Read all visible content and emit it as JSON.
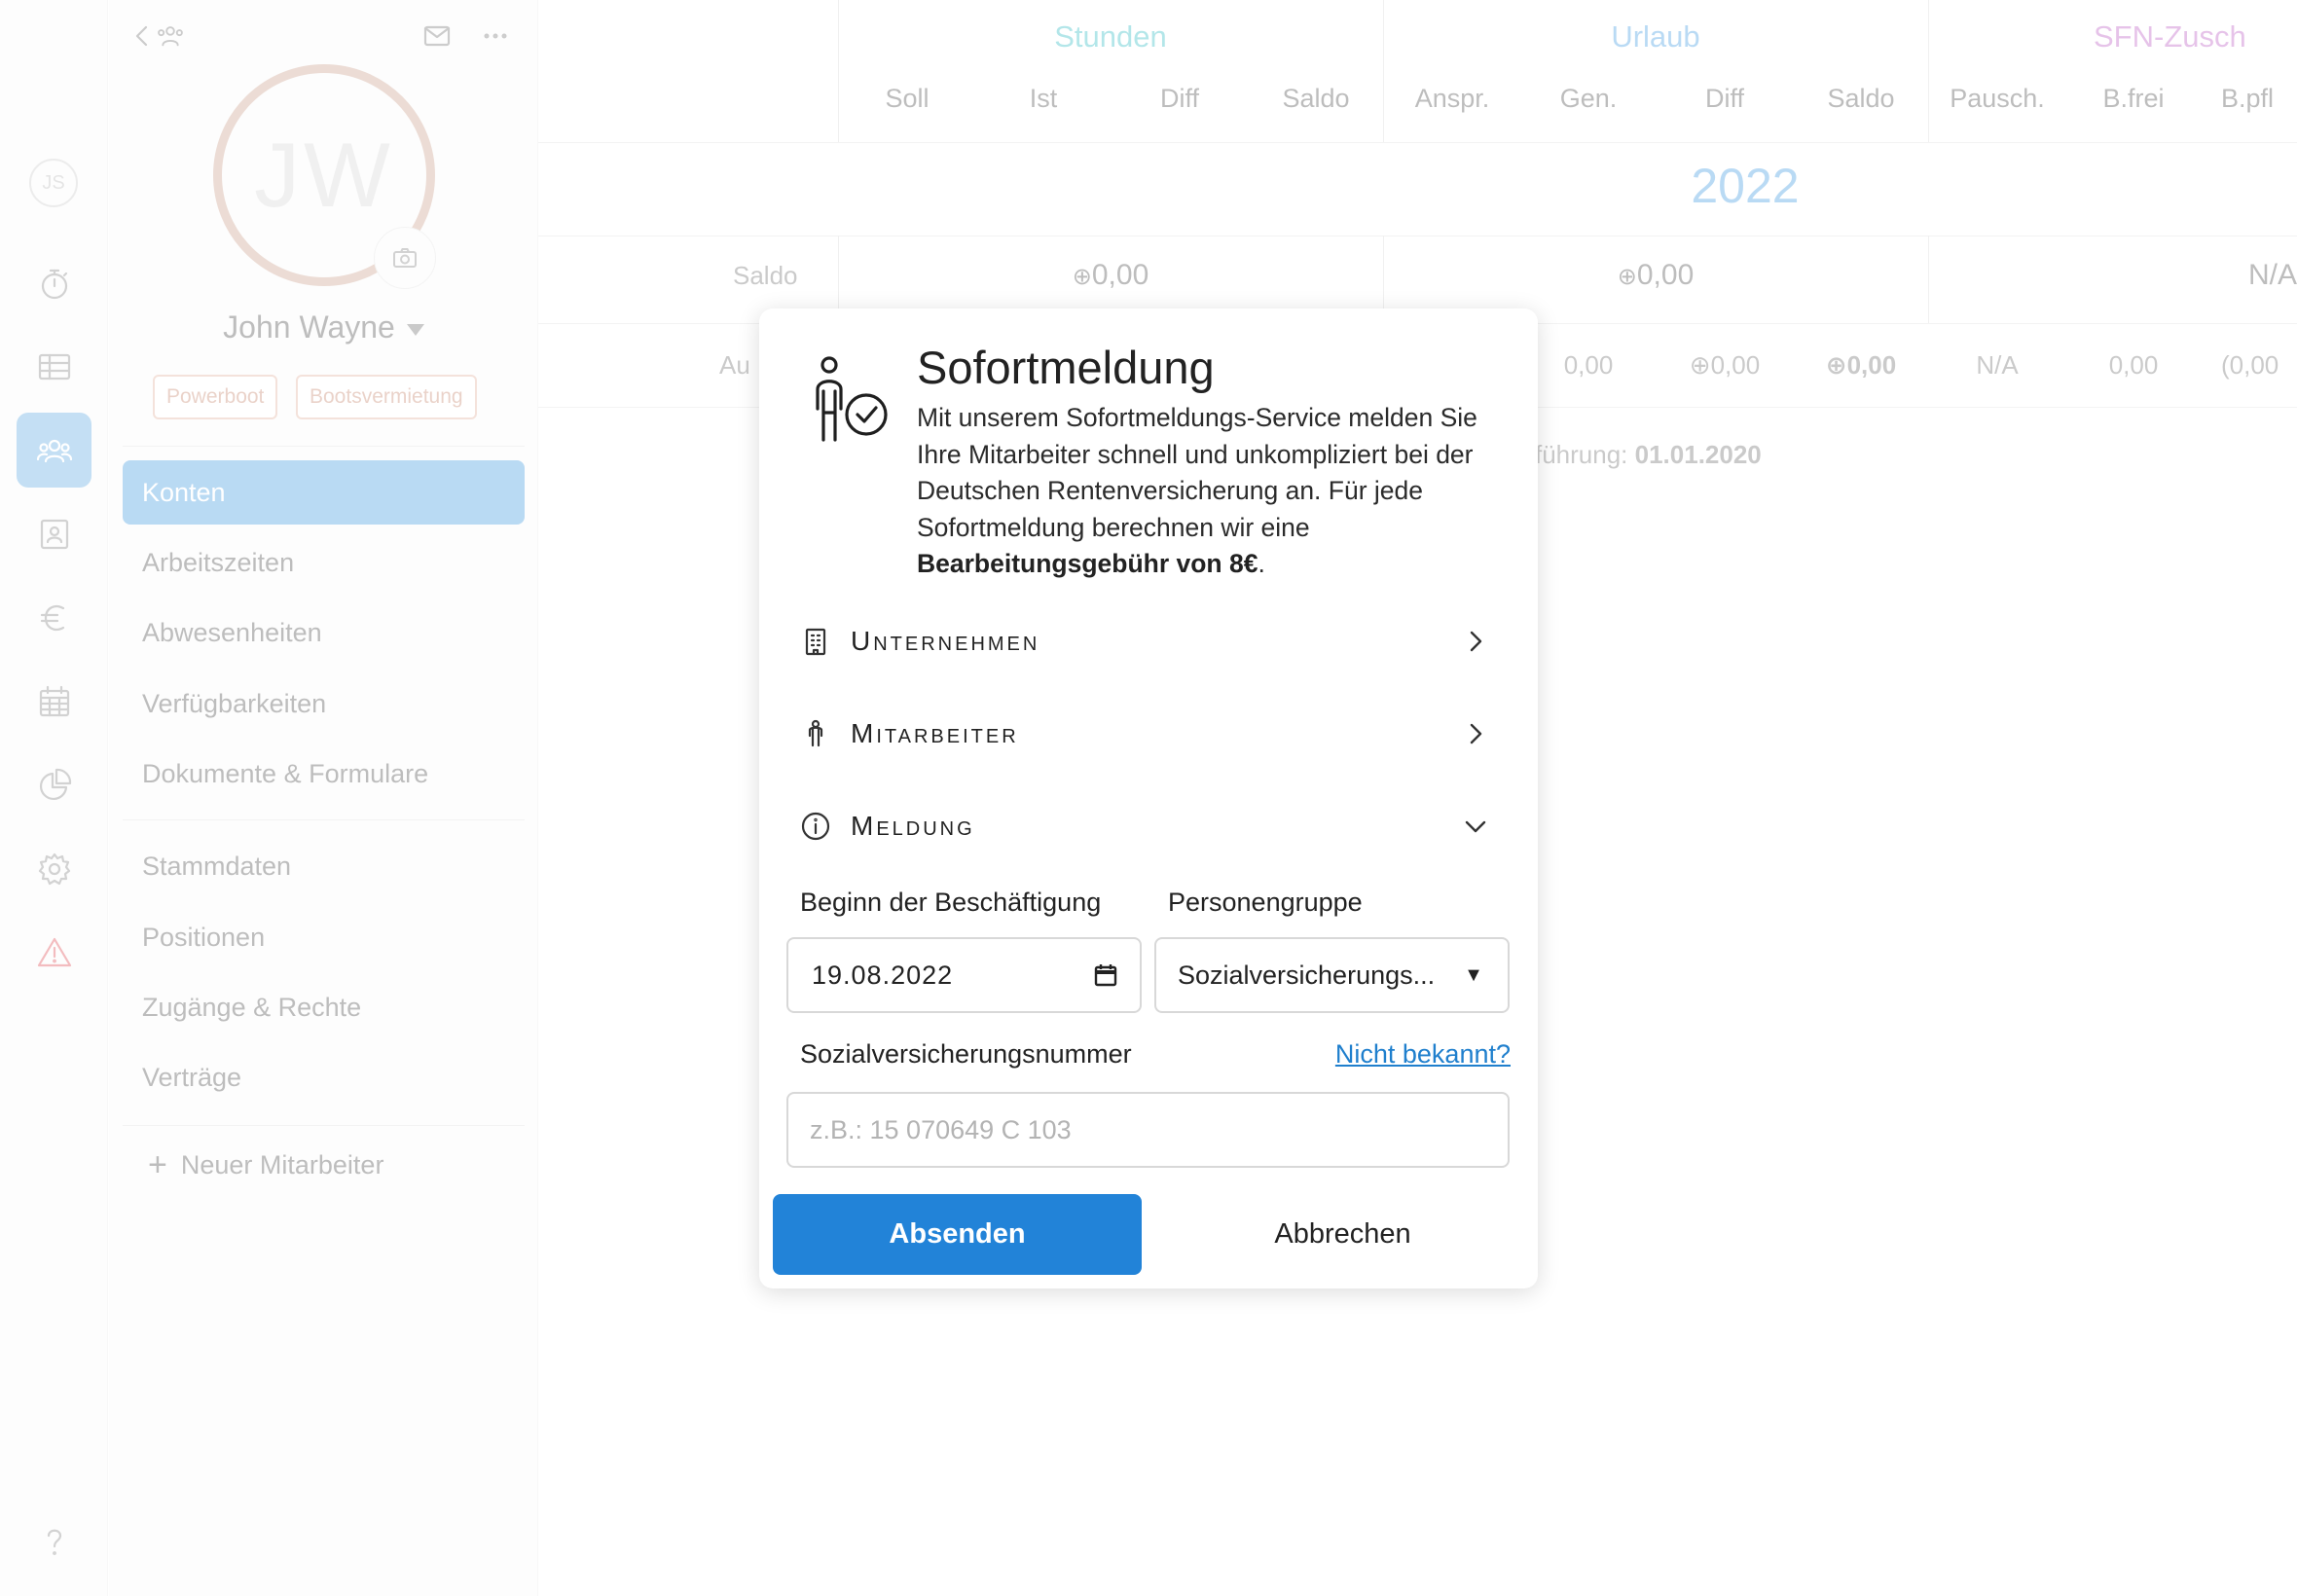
{
  "rail": {
    "avatar_initials": "JS",
    "icons": [
      "timer-icon",
      "table-icon",
      "team-icon",
      "contact-card-icon",
      "euro-icon",
      "calendar-icon",
      "pie-chart-icon",
      "gear-icon",
      "warning-icon",
      "help-icon"
    ],
    "active": "team-icon"
  },
  "sidebar": {
    "avatar_initials": "JW",
    "name": "John Wayne",
    "tags": [
      "Powerboot",
      "Bootsvermietung"
    ],
    "nav_primary": [
      "Konten",
      "Arbeitszeiten",
      "Abwesenheiten",
      "Verfügbarkeiten",
      "Dokumente & Formulare"
    ],
    "nav_secondary": [
      "Stammdaten",
      "Positionen",
      "Zugänge & Rechte",
      "Verträge"
    ],
    "new_employee": "Neuer Mitarbeiter",
    "accent_color": "#4a9fe2"
  },
  "table": {
    "groups": [
      {
        "label": "Stunden",
        "color": "#39c0c8"
      },
      {
        "label": "Urlaub",
        "color": "#4aa0e4"
      },
      {
        "label": "SFN-Zusch",
        "color": "#c064c8"
      }
    ],
    "columns": [
      "Soll",
      "Ist",
      "Diff",
      "Saldo",
      "Anspr.",
      "Gen.",
      "Diff",
      "Saldo",
      "Pausch.",
      "B.frei",
      "B.pfl"
    ],
    "year": "2022",
    "row_saldo": {
      "label": "Saldo",
      "stunden": "0,00",
      "urlaub": "0,00",
      "sfn": "N/A"
    },
    "row_partial": {
      "label": "Au",
      "values": [
        "0,00",
        "0,00",
        "0,00",
        "N/A",
        "0,00",
        "(0,00"
      ]
    },
    "intro_text": "führung:",
    "intro_date": "01.01.2020"
  },
  "modal": {
    "title": "Sofortmeldung",
    "description": "Mit unserem Sofortmeldungs-Service melden Sie Ihre Mitarbeiter schnell und unkompliziert bei der Deutschen Rentenversicherung an. Für jede Sofortmeldung berechnen wir eine",
    "description_bold": "Bearbeitungsgebühr von 8€",
    "description_end": ".",
    "sections": [
      {
        "label": "Unternehmen",
        "icon": "building-icon",
        "state": "collapsed"
      },
      {
        "label": "Mitarbeiter",
        "icon": "person-icon",
        "state": "collapsed"
      },
      {
        "label": "Meldung",
        "icon": "info-icon",
        "state": "expanded"
      }
    ],
    "start_label": "Beginn der Beschäftigung",
    "start_value": "19.08.2022",
    "group_label": "Personengruppe",
    "group_value": "Sozialversicherungs...",
    "svn_label": "Sozialversicherungsnummer",
    "svn_link": "Nicht bekannt?",
    "svn_placeholder": "z.B.: 15 070649 C 103",
    "submit": "Absenden",
    "cancel": "Abbrechen",
    "primary_color": "#2283d8"
  }
}
